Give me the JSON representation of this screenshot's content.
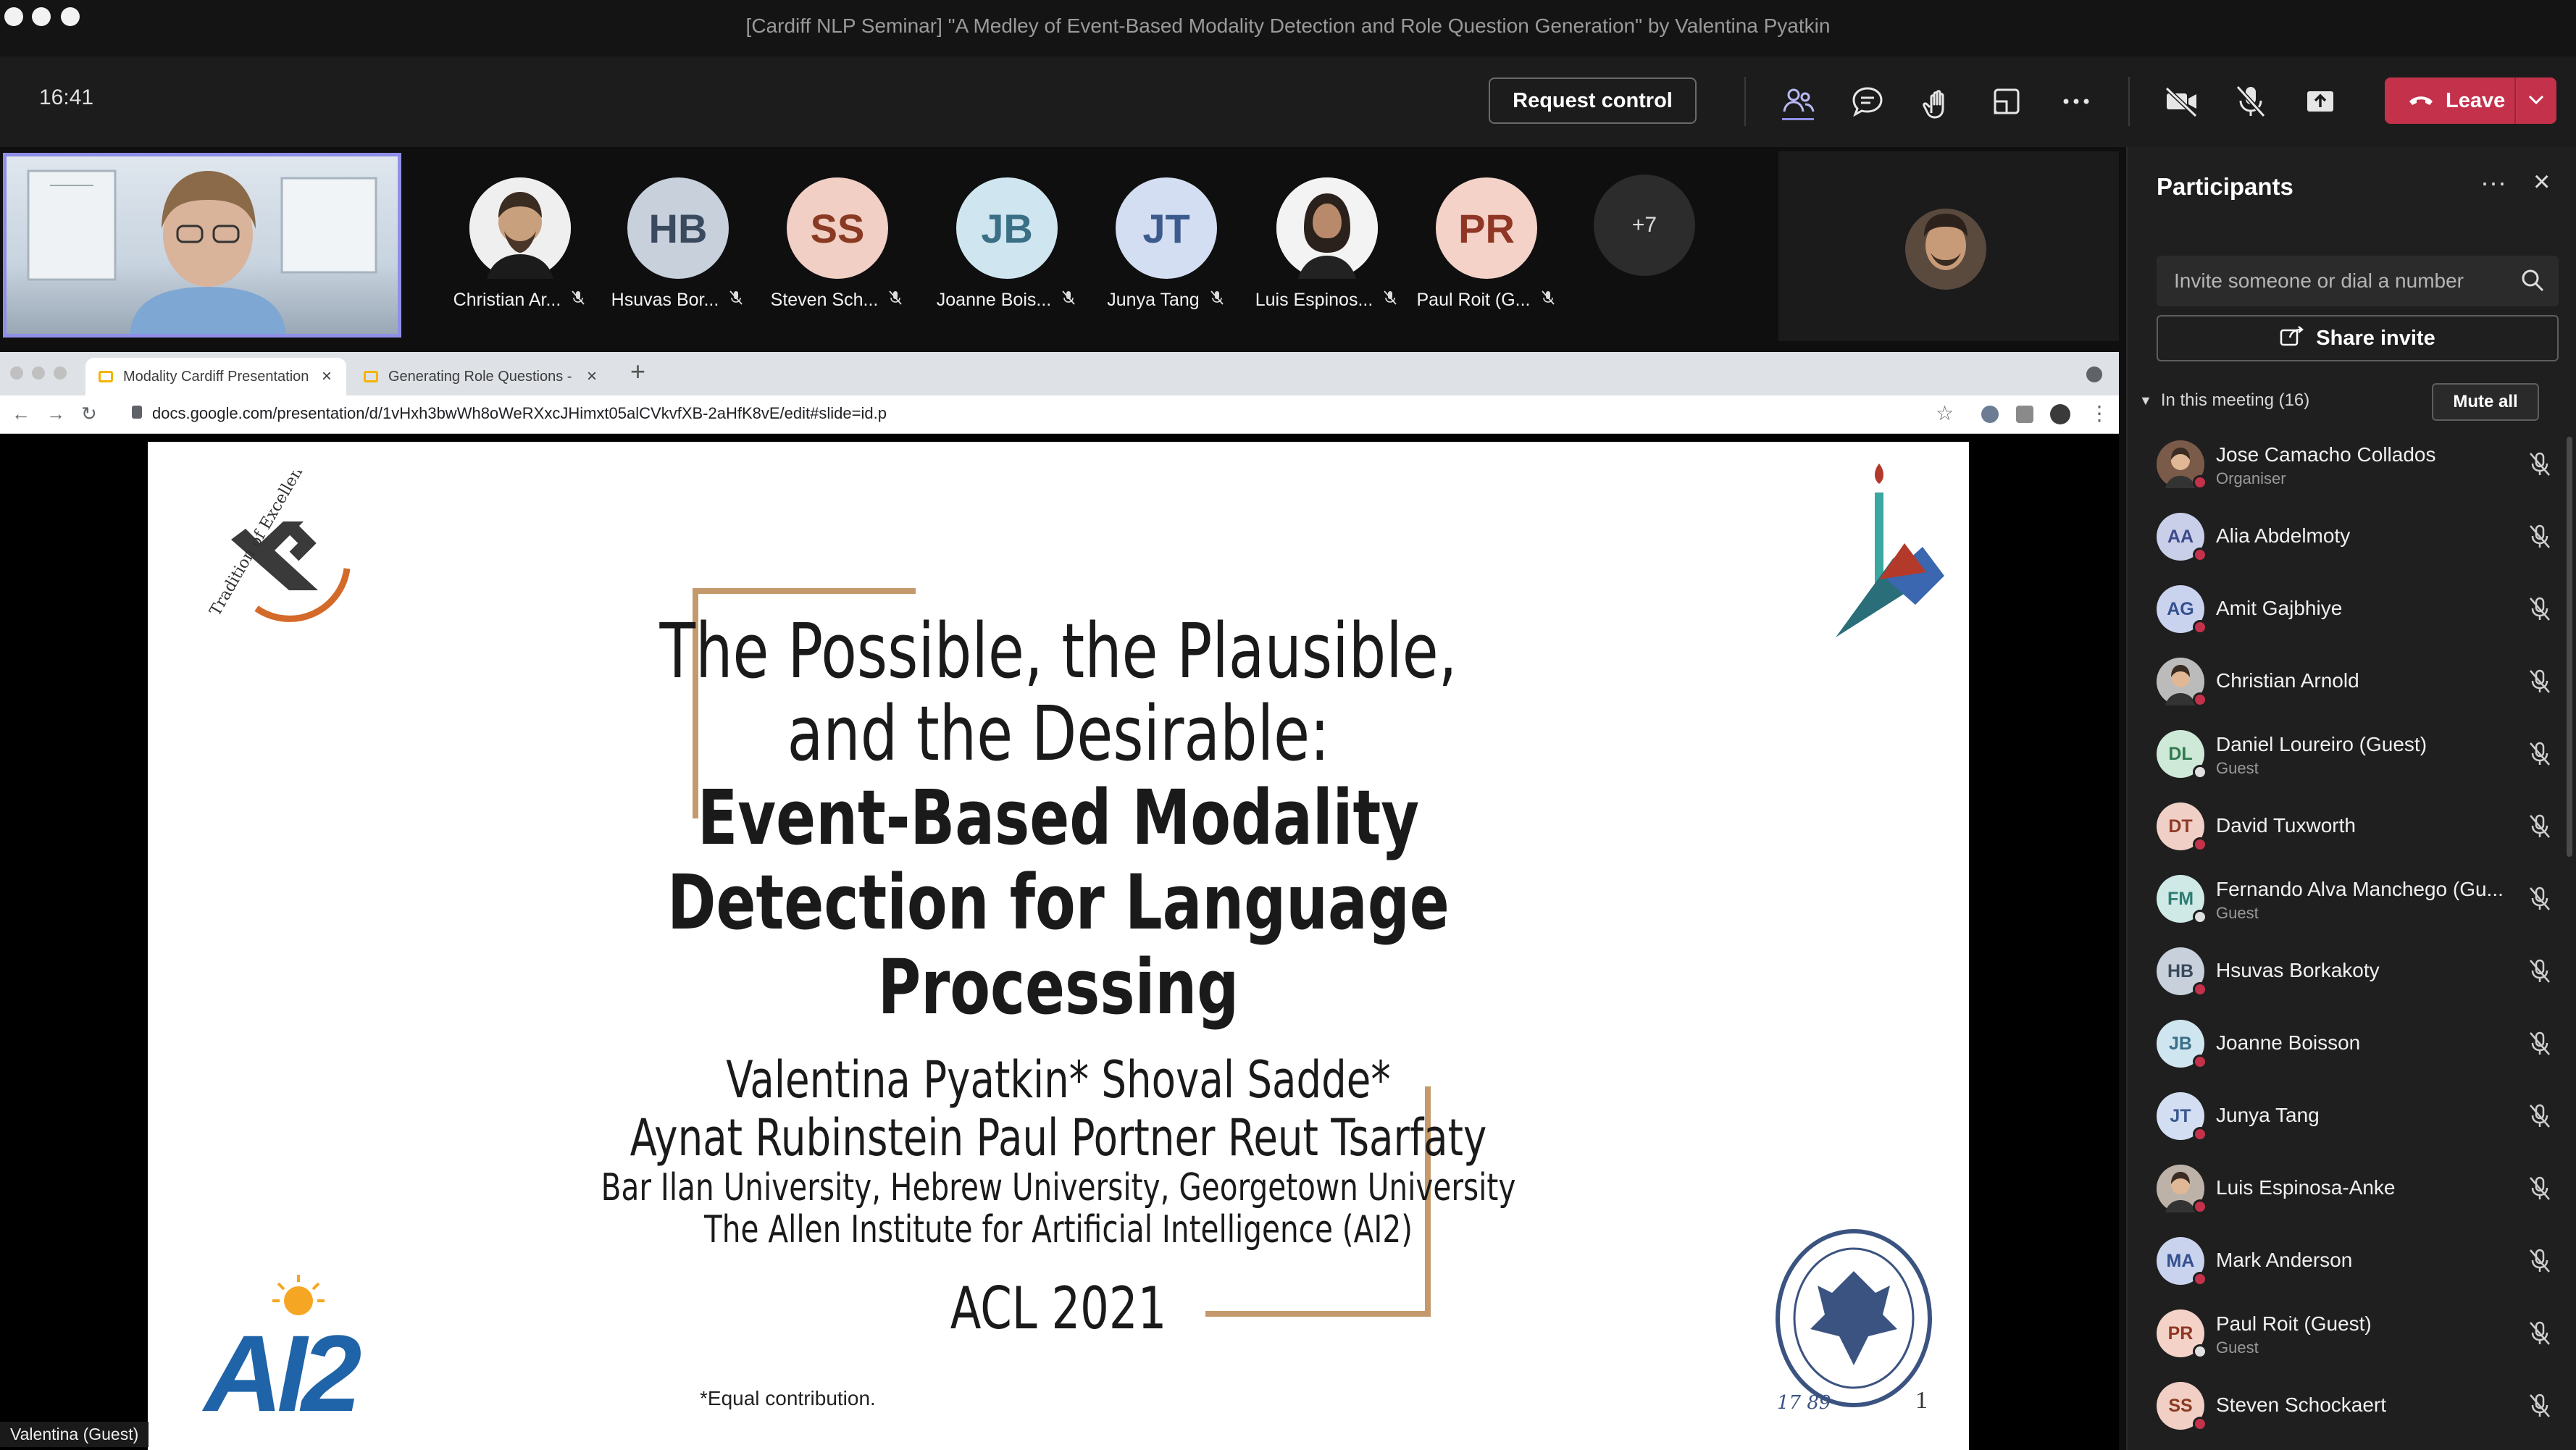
{
  "window": {
    "title": "[Cardiff NLP Seminar] \"A Medley of Event-Based Modality Detection and Role Question Generation\" by Valentina Pyatkin"
  },
  "toolbar": {
    "time": "16:41",
    "request_control_label": "Request control",
    "leave_label": "Leave",
    "icons": [
      "people-icon",
      "chat-icon",
      "reactions-icon",
      "share-tray-icon",
      "more-icon",
      "camera-off-icon",
      "mic-off-icon",
      "share-content-icon"
    ],
    "accent": "#c4314b"
  },
  "video_strip": {
    "self_label": "Valentina (Guest)",
    "participants": [
      {
        "name": "Christian Ar...",
        "initials": "",
        "bg": "#d9d9d9",
        "fg": "#333333",
        "photo": true
      },
      {
        "name": "Hsuvas Bor...",
        "initials": "HB",
        "bg": "#c7d0db",
        "fg": "#3a4a5e"
      },
      {
        "name": "Steven Sch...",
        "initials": "SS",
        "bg": "#f1cfc4",
        "fg": "#8a3a22"
      },
      {
        "name": "Joanne Bois...",
        "initials": "JB",
        "bg": "#cfe6f0",
        "fg": "#3a6f86"
      },
      {
        "name": "Junya Tang",
        "initials": "JT",
        "bg": "#d3def3",
        "fg": "#3d5a8c"
      },
      {
        "name": "Luis Espinos...",
        "initials": "",
        "bg": "#e8e8e8",
        "fg": "#333333",
        "photo": true
      },
      {
        "name": "Paul Roit (G...",
        "initials": "PR",
        "bg": "#f4d2c8",
        "fg": "#8f3624"
      }
    ],
    "more": "+7"
  },
  "browser": {
    "tabs": [
      "Modality Cardiff Presentation",
      "Generating Role Questions - G"
    ],
    "url": "docs.google.com/presentation/d/1vHxh3bwWh8oWeRXxcJHimxt05alCVkvfXB-2aHfK8vE/edit#slide=id.p"
  },
  "slide": {
    "logo_left_text": "Tradition of Excellence",
    "logo_ai2_text": "AI2",
    "title_lines": [
      "The Possible, the Plausible,",
      "and the Desirable:"
    ],
    "bold_lines": [
      "Event-Based Modality",
      "Detection for Language",
      "Processing"
    ],
    "authors_1": "Valentina Pyatkin* Shoval Sadde*",
    "authors_2": "Aynat Rubinstein Paul Portner Reut Tsarfaty",
    "affiliation_1": "Bar Ilan University, Hebrew University, Georgetown University",
    "affiliation_2": "The Allen Institute for Artificial Intelligence (AI2)",
    "venue": "ACL 2021",
    "footnote": "*Equal contribution.",
    "seal_years": "17 89",
    "page_number": "1"
  },
  "panel": {
    "title": "Participants",
    "invite_placeholder": "Invite someone or dial a number",
    "share_invite_label": "Share invite",
    "in_meeting_label": "In this meeting (16)",
    "mute_all_label": "Mute all",
    "participants": [
      {
        "name": "Jose Camacho Collados",
        "sub": "Organiser",
        "initials": "",
        "bg": "#7a5a48",
        "fg": "#ffffff",
        "dot": "red"
      },
      {
        "name": "Alia Abdelmoty",
        "sub": "",
        "initials": "AA",
        "bg": "#c9cfe8",
        "fg": "#3b4a8a",
        "dot": "red"
      },
      {
        "name": "Amit Gajbhiye",
        "sub": "",
        "initials": "AG",
        "bg": "#c9d3ee",
        "fg": "#34508f",
        "dot": "red"
      },
      {
        "name": "Christian Arnold",
        "sub": "",
        "initials": "",
        "bg": "#bbbbbb",
        "fg": "#333333",
        "dot": "red"
      },
      {
        "name": "Daniel Loureiro (Guest)",
        "sub": "Guest",
        "initials": "DL",
        "bg": "#cfe9d9",
        "fg": "#2f7a4d",
        "dot": "grey"
      },
      {
        "name": "David Tuxworth",
        "sub": "",
        "initials": "DT",
        "bg": "#f0cfc6",
        "fg": "#8f3a26",
        "dot": "red"
      },
      {
        "name": "Fernando Alva Manchego (Gu...",
        "sub": "Guest",
        "initials": "FM",
        "bg": "#cfeae6",
        "fg": "#2f7c73",
        "dot": "grey"
      },
      {
        "name": "Hsuvas Borkakoty",
        "sub": "",
        "initials": "HB",
        "bg": "#c7d0db",
        "fg": "#3a4a5e",
        "dot": "red"
      },
      {
        "name": "Joanne Boisson",
        "sub": "",
        "initials": "JB",
        "bg": "#cfe6f0",
        "fg": "#3a6f86",
        "dot": "red"
      },
      {
        "name": "Junya Tang",
        "sub": "",
        "initials": "JT",
        "bg": "#d3def3",
        "fg": "#3d5a8c",
        "dot": "red"
      },
      {
        "name": "Luis Espinosa-Anke",
        "sub": "",
        "initials": "",
        "bg": "#bcb2a8",
        "fg": "#333333",
        "dot": "red"
      },
      {
        "name": "Mark Anderson",
        "sub": "",
        "initials": "MA",
        "bg": "#c9d3ee",
        "fg": "#34508f",
        "dot": "red"
      },
      {
        "name": "Paul Roit (Guest)",
        "sub": "Guest",
        "initials": "PR",
        "bg": "#f4d2c8",
        "fg": "#8f3624",
        "dot": "grey"
      },
      {
        "name": "Steven Schockaert",
        "sub": "",
        "initials": "SS",
        "bg": "#f1cfc4",
        "fg": "#8a3a22",
        "dot": "red"
      }
    ]
  }
}
